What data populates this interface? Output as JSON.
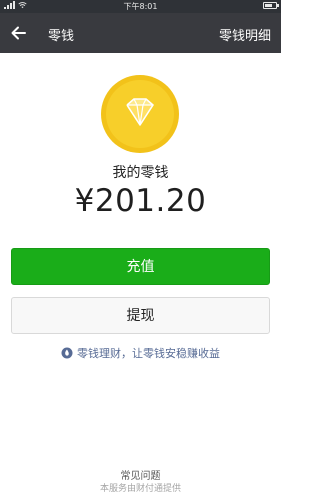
{
  "status_bar": {
    "time": "下午8:01",
    "carrier_signal_icon": "signal-icon",
    "wifi_icon": "wifi-icon",
    "battery_icon": "battery-icon"
  },
  "nav": {
    "back_icon": "back-arrow-icon",
    "title": "零钱",
    "detail_label": "零钱明细"
  },
  "wallet": {
    "coin_icon": "diamond-coin-icon",
    "balance_label": "我的零钱",
    "balance_amount": "¥201.20"
  },
  "actions": {
    "recharge_label": "充值",
    "withdraw_label": "提现"
  },
  "promo": {
    "icon": "licaitong-icon",
    "text": "零钱理财，让零钱安稳赚收益"
  },
  "footer": {
    "faq_label": "常见问题",
    "provider_text": "本服务由财付通提供"
  },
  "colors": {
    "nav_bg": "#393a3f",
    "primary_green": "#1aad19",
    "coin_gold": "#f2c21a",
    "link_blue": "#576b95"
  }
}
